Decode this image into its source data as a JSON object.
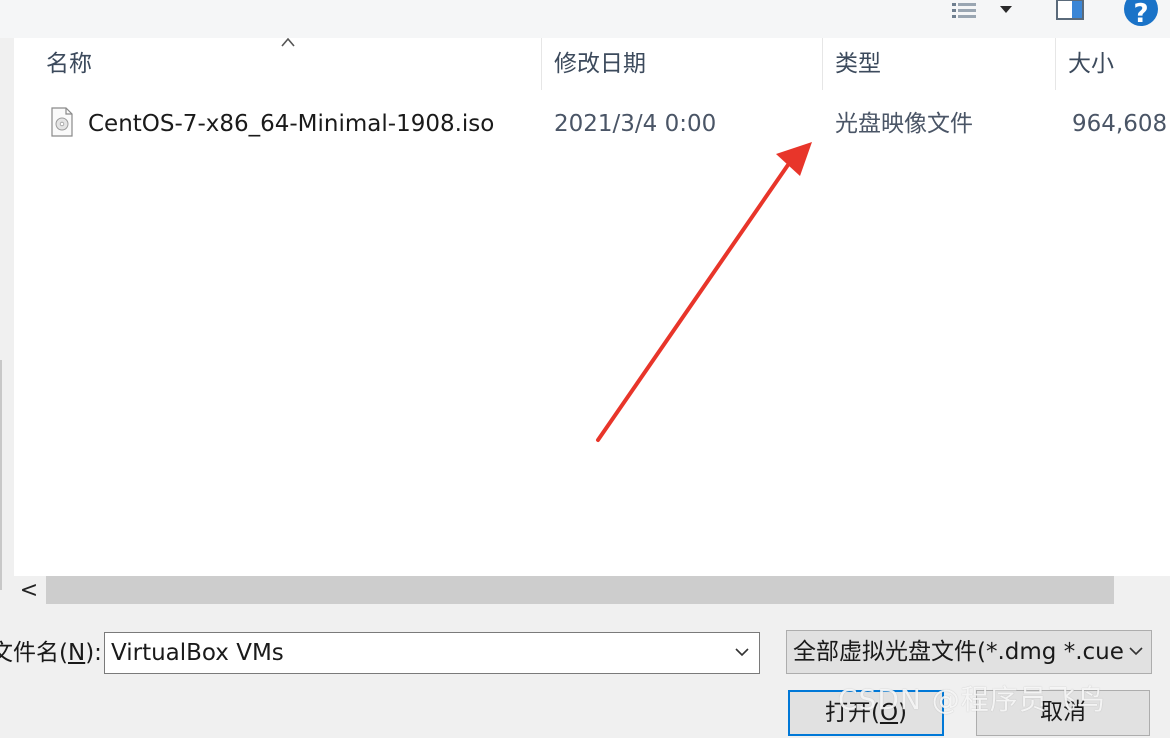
{
  "toolbar": {
    "view_icon": "details-view-icon",
    "view_dropdown_icon": "caret-down-icon",
    "pane_icon": "preview-pane-icon",
    "help_icon": "help-icon",
    "help_glyph": "?"
  },
  "file_list": {
    "columns": [
      "名称",
      "修改日期",
      "类型",
      "大小"
    ],
    "sort_indicator": "sort-ascending-icon",
    "rows": [
      {
        "icon": "disc-image-file-icon",
        "name": "CentOS-7-x86_64-Minimal-1908.iso",
        "modified": "2021/3/4 0:00",
        "type": "光盘映像文件",
        "size": "964,608"
      }
    ]
  },
  "annotation": {
    "arrow_color": "#e8352a"
  },
  "scrollbar": {
    "left_glyph": "<"
  },
  "filename": {
    "label_prefix": "文件名(",
    "label_key": "N",
    "label_suffix": "):",
    "value": "VirtualBox VMs"
  },
  "filetype": {
    "value": "全部虚拟光盘文件(*.dmg *.cue"
  },
  "buttons": {
    "open_prefix": "打开(",
    "open_key": "O",
    "open_suffix": ")",
    "cancel": "取消"
  },
  "watermark": "CSDN @程序员飞鸟",
  "colors": {
    "accent": "#0078d7",
    "help": "#1a73c8",
    "arrow": "#e8352a"
  }
}
